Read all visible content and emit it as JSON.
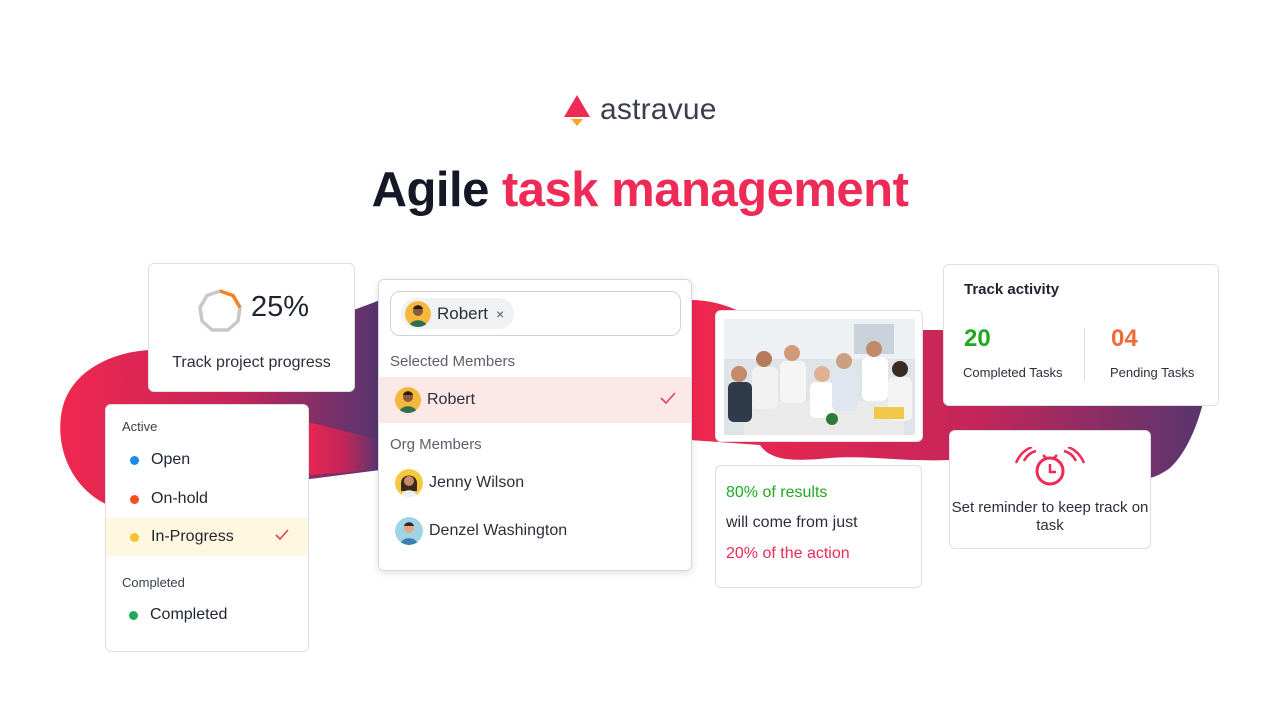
{
  "brand": {
    "name": "astravue"
  },
  "headline": {
    "dark": "Agile",
    "accent": "task management"
  },
  "progress": {
    "value": 25,
    "label": "25%",
    "caption": "Track project progress"
  },
  "status": {
    "sections": [
      {
        "title": "Active",
        "items": [
          {
            "label": "Open",
            "color": "#1e88e5",
            "selected": false
          },
          {
            "label": "On-hold",
            "color": "#f4511e",
            "selected": false
          },
          {
            "label": "In-Progress",
            "color": "#fbc02d",
            "selected": true
          }
        ]
      },
      {
        "title": "Completed",
        "items": [
          {
            "label": "Completed",
            "color": "#1faa59",
            "selected": false
          }
        ]
      }
    ]
  },
  "members": {
    "chip": "Robert",
    "chip_remove": "×",
    "selected_title": "Selected  Members",
    "selected": [
      {
        "name": "Robert"
      }
    ],
    "org_title": "Org Members",
    "org": [
      {
        "name": "Jenny Wilson"
      },
      {
        "name": "Denzel Washington"
      }
    ]
  },
  "quote": {
    "line1": "80% of results",
    "line2": "will come from just",
    "line3": "20% of the action",
    "colors": {
      "line1": "#1fa91f",
      "line2": "#2a2f3b",
      "line3": "#ee2a56"
    }
  },
  "activity": {
    "title": "Track activity",
    "completed": {
      "value": "20",
      "label": "Completed Tasks",
      "color": "#1fa91f"
    },
    "pending": {
      "value": "04",
      "label": "Pending Tasks",
      "color": "#f06a3a"
    }
  },
  "reminder": {
    "text": "Set reminder to keep track on task",
    "color": "#ee2a56"
  },
  "colors": {
    "accent": "#ee2a56",
    "blob_start": "#f0274f",
    "blob_end": "#5a3570"
  }
}
